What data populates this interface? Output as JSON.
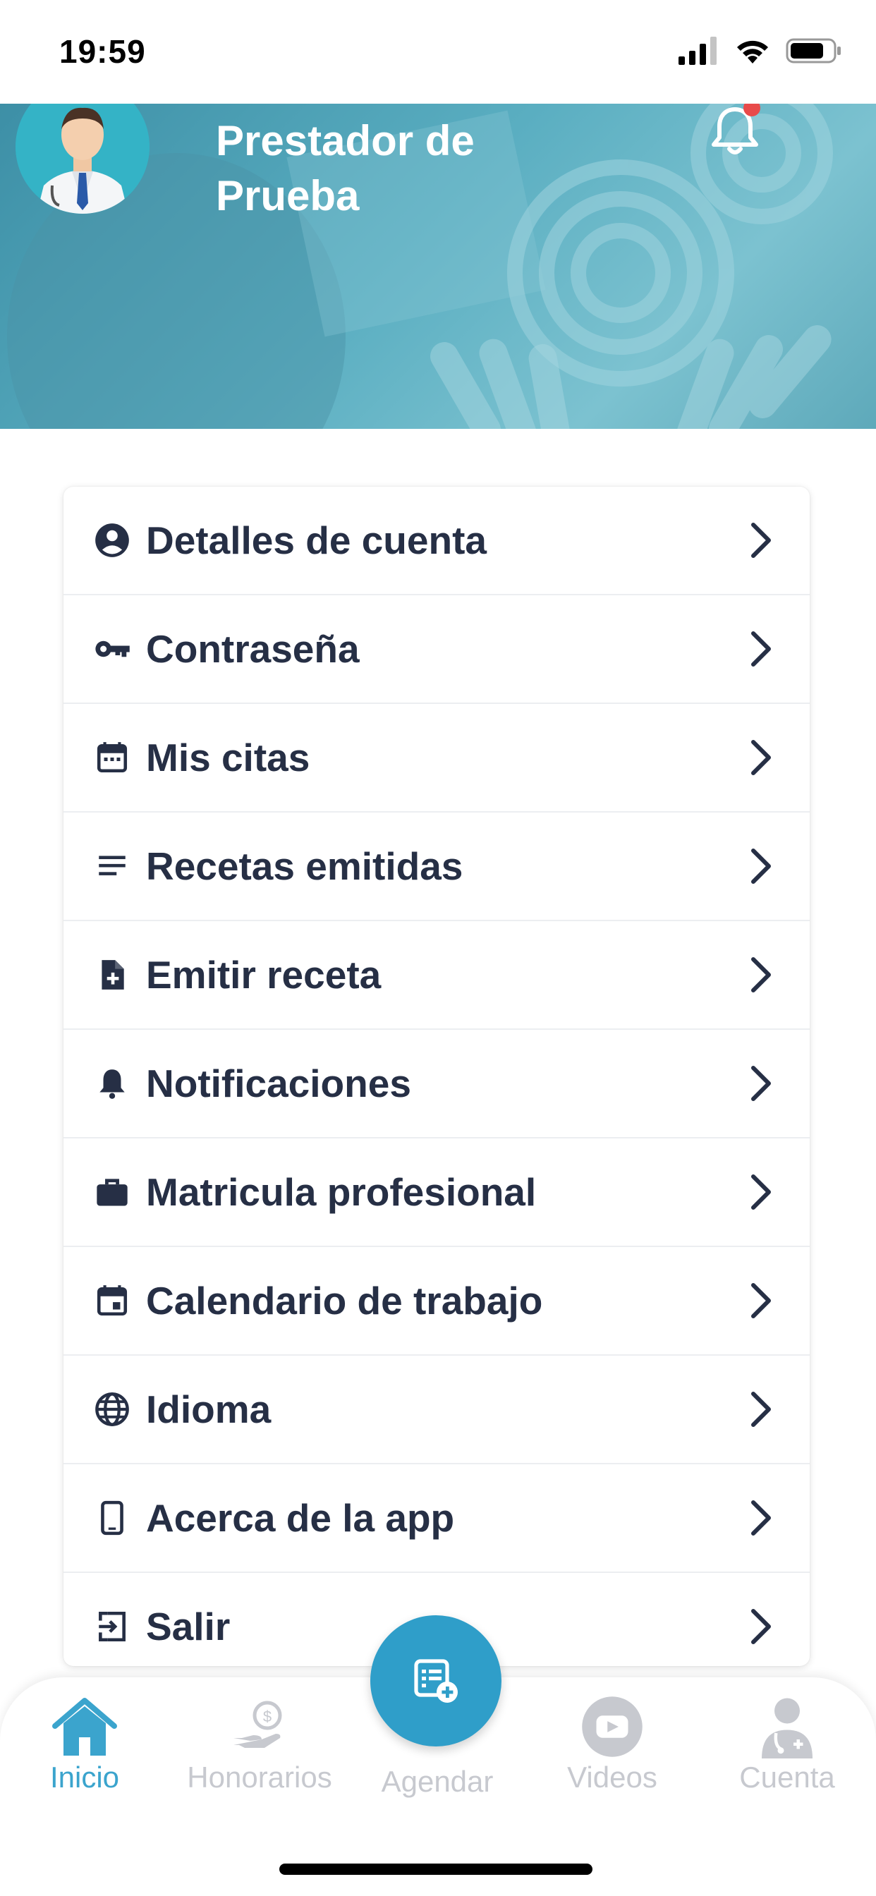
{
  "status_bar": {
    "time": "19:59"
  },
  "header": {
    "user_name": "Prestador de Prueba",
    "has_notification_badge": true
  },
  "menu": {
    "items": [
      {
        "label": "Detalles de cuenta",
        "icon": "account-circle-icon"
      },
      {
        "label": "Contraseña",
        "icon": "key-icon"
      },
      {
        "label": "Mis citas",
        "icon": "calendar-dots-icon"
      },
      {
        "label": "Recetas emitidas",
        "icon": "lines-icon"
      },
      {
        "label": "Emitir receta",
        "icon": "file-add-icon"
      },
      {
        "label": "Notificaciones",
        "icon": "bell-icon"
      },
      {
        "label": "Matricula profesional",
        "icon": "briefcase-icon"
      },
      {
        "label": "Calendario de trabajo",
        "icon": "calendar-event-icon"
      },
      {
        "label": "Idioma",
        "icon": "globe-icon"
      },
      {
        "label": "Acerca de la app",
        "icon": "phone-icon"
      },
      {
        "label": "Salir",
        "icon": "logout-icon"
      }
    ]
  },
  "bottom_nav": {
    "items": [
      {
        "label": "Inicio",
        "icon": "home-icon",
        "active": true
      },
      {
        "label": "Honorarios",
        "icon": "money-hand-icon",
        "active": false
      },
      {
        "label": "Agendar",
        "icon": "schedule-add-icon",
        "active": false
      },
      {
        "label": "Videos",
        "icon": "play-icon",
        "active": false
      },
      {
        "label": "Cuenta",
        "icon": "doctor-icon",
        "active": false
      }
    ]
  },
  "colors": {
    "accent": "#2f9ec9",
    "active_nav": "#3ba4cd",
    "inactive_nav": "#c7c9cf",
    "text_dark": "#262f45",
    "badge": "#e84a4a"
  }
}
